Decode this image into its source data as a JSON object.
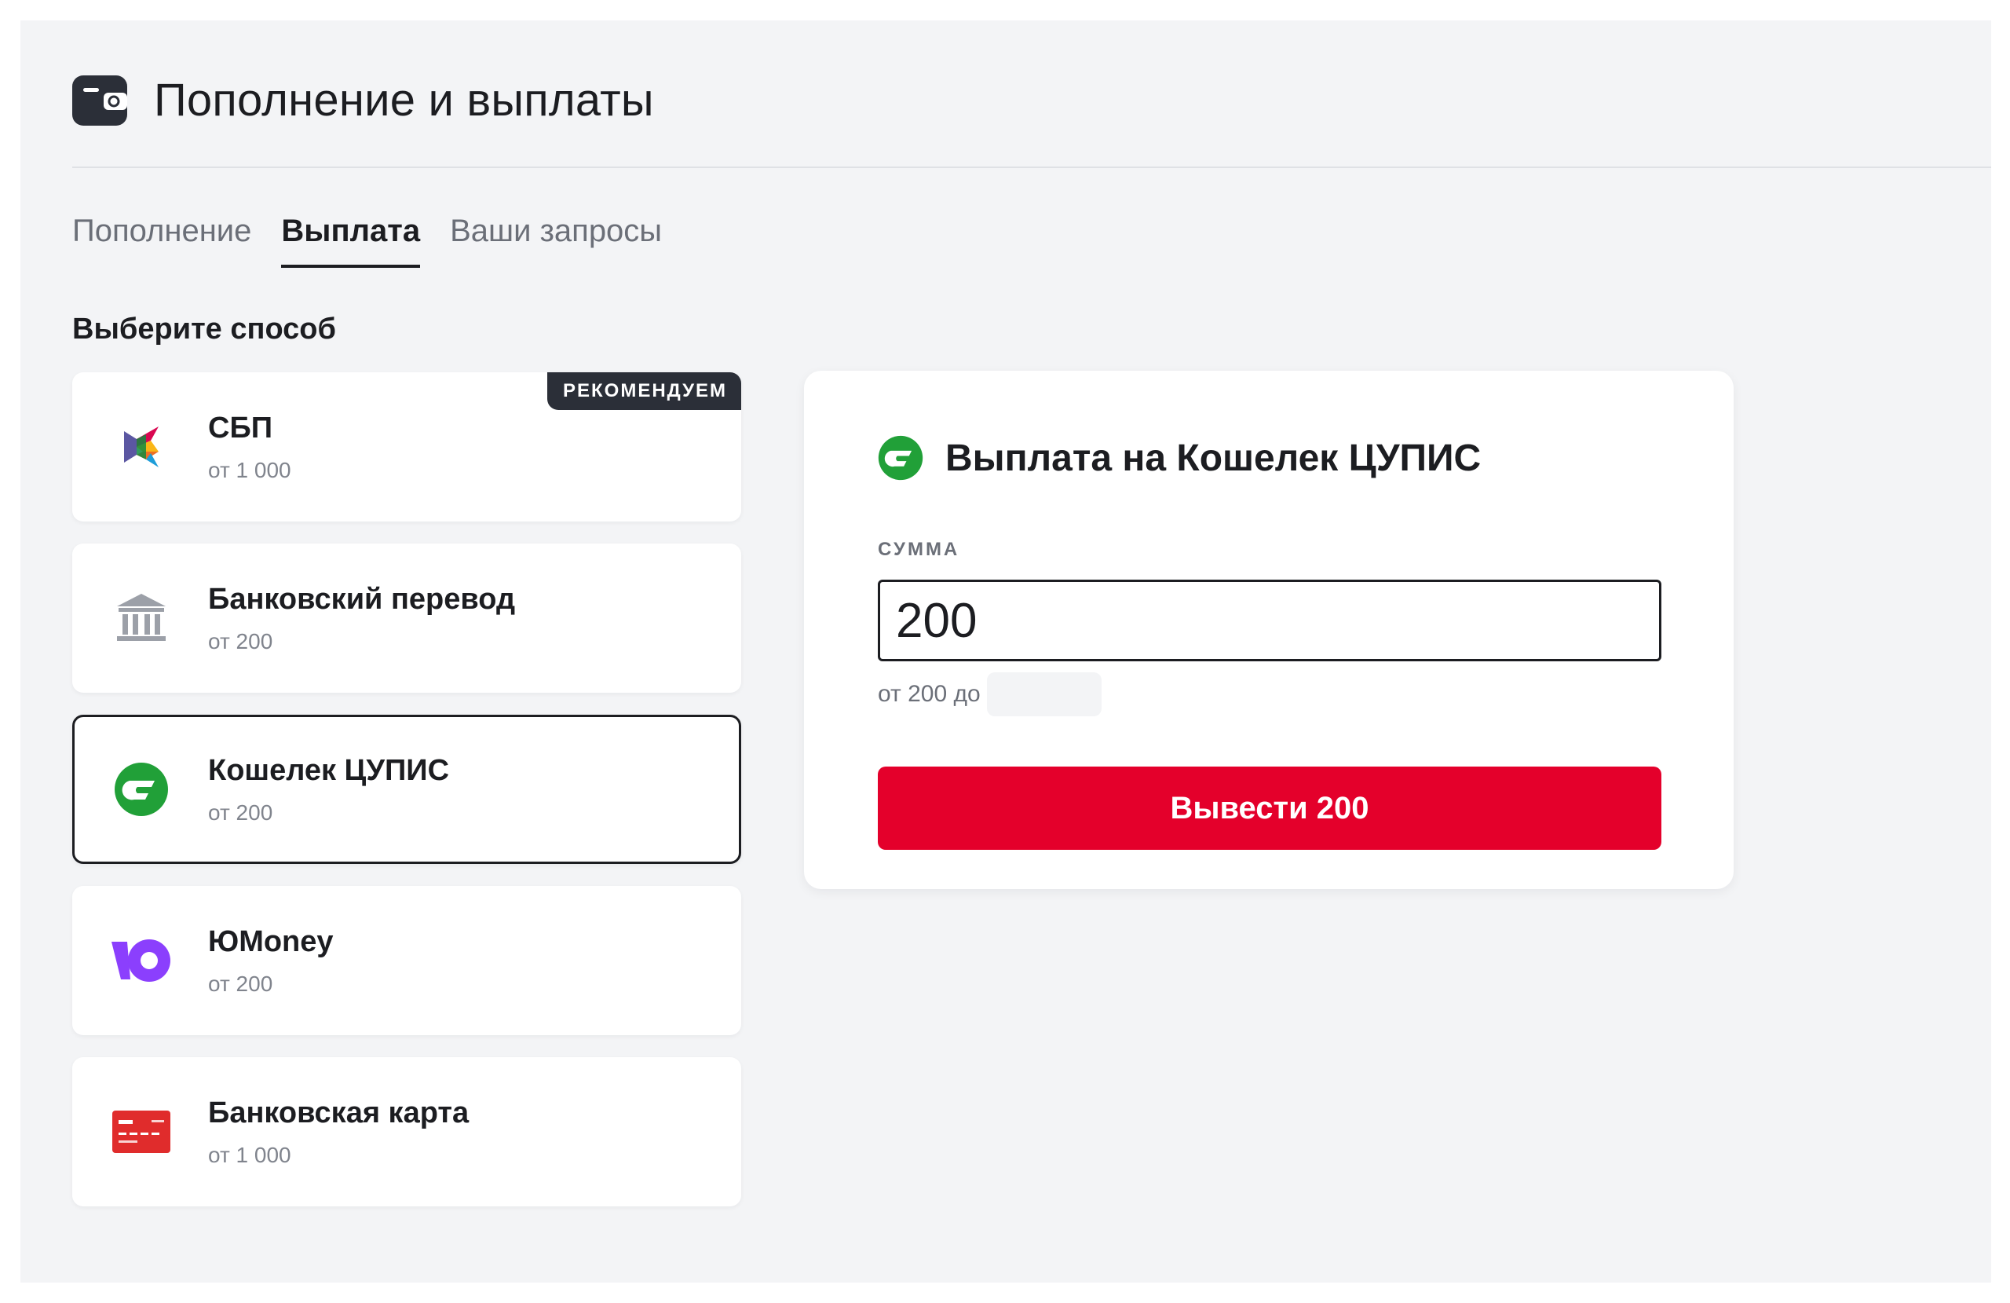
{
  "header": {
    "title": "Пополнение и выплаты",
    "icon": "wallet-icon"
  },
  "tabs": [
    {
      "label": "Пополнение",
      "active": false
    },
    {
      "label": "Выплата",
      "active": true
    },
    {
      "label": "Ваши запросы",
      "active": false
    }
  ],
  "methods_section": {
    "label": "Выберите способ"
  },
  "methods": [
    {
      "name": "СБП",
      "min": "от 1 000",
      "badge": "РЕКОМЕНДУЕМ",
      "icon": "sbp-logo-icon",
      "selected": false
    },
    {
      "name": "Банковский перевод",
      "min": "от 200",
      "icon": "bank-building-icon",
      "selected": false
    },
    {
      "name": "Кошелек ЦУПИС",
      "min": "от 200",
      "icon": "cupis-wallet-icon",
      "selected": true
    },
    {
      "name": "ЮMoney",
      "min": "от 200",
      "icon": "yumoney-logo-icon",
      "selected": false
    },
    {
      "name": "Банковская карта",
      "min": "от 1 000",
      "icon": "bank-card-icon",
      "selected": false
    }
  ],
  "payout": {
    "title": "Выплата на Кошелек ЦУПИС",
    "icon": "cupis-wallet-icon",
    "amount_label": "СУММА",
    "amount_value": "200",
    "range_text": "от 200 до",
    "submit_label": "Вывести 200"
  },
  "colors": {
    "accent_red": "#e4002b",
    "dark": "#1c1d21",
    "page_bg": "#f3f4f6",
    "cupis_green": "#21a038",
    "yumoney_purple": "#8b3ffd",
    "card_red": "#e02c2c"
  }
}
